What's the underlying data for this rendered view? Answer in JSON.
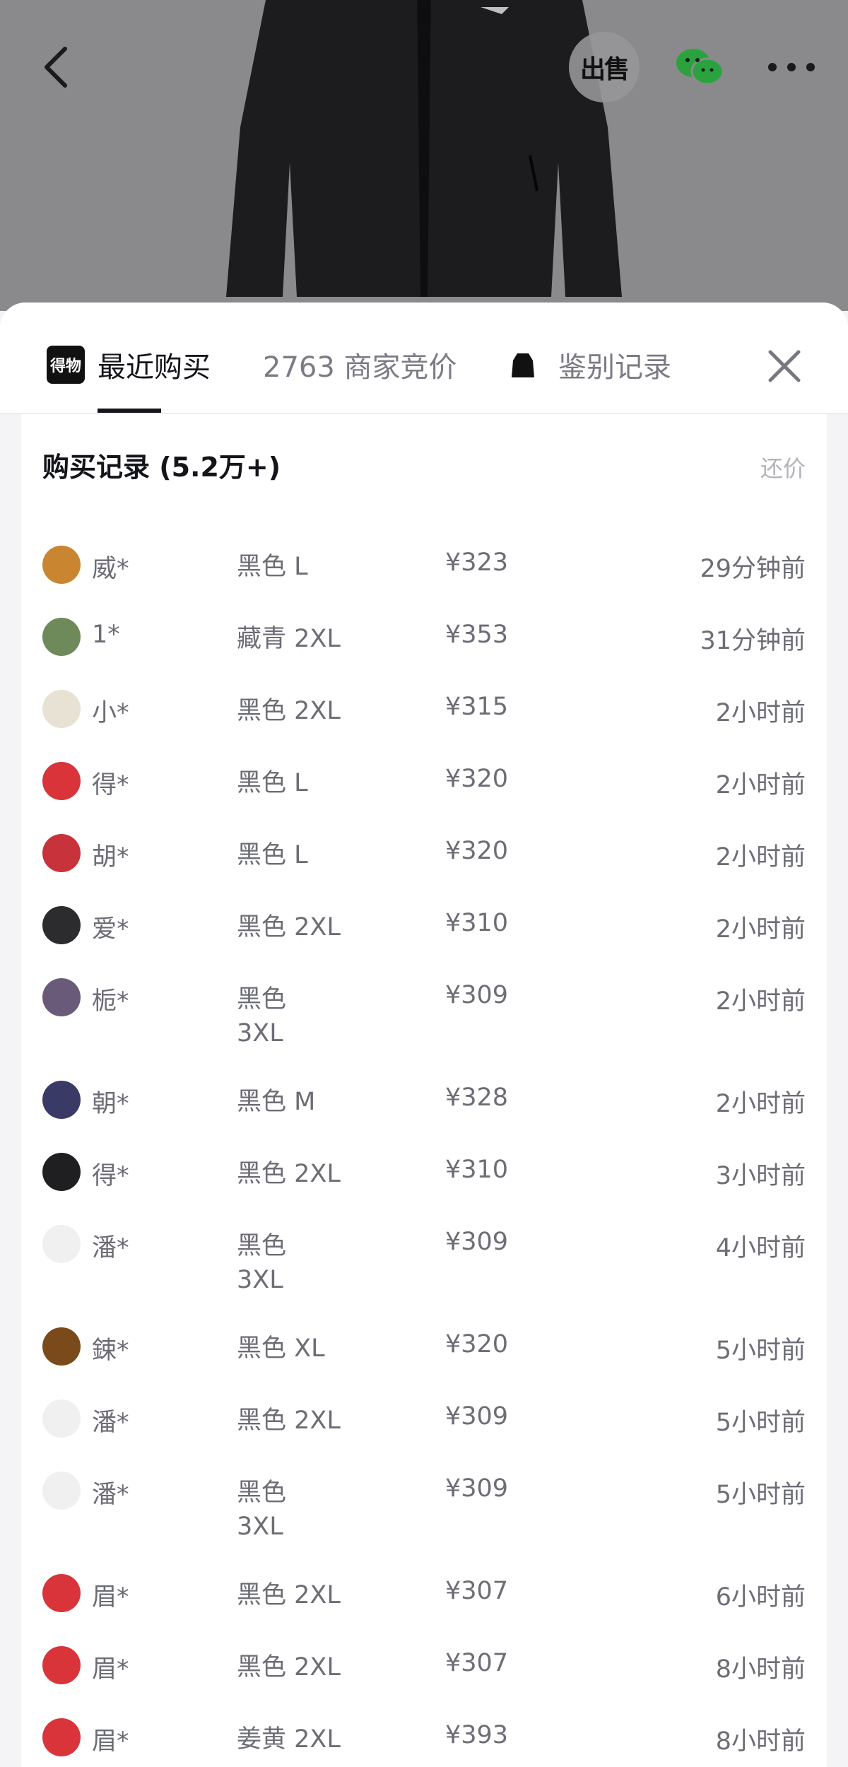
{
  "header": {
    "sell_label": "出售",
    "back_icon": "chevron-left-icon",
    "share_icon": "wechat-icon",
    "more_icon": "ellipsis-icon"
  },
  "tabs": {
    "recent": "最近购买",
    "logo_text": "得物",
    "bid": "2763 商家竞价",
    "auth": "鉴别记录",
    "close_icon": "close-icon"
  },
  "records": {
    "title": "购买记录 (5.2万+)",
    "counter_offer": "还价",
    "rows": [
      {
        "user": "威*",
        "color": "黑色",
        "size": "L",
        "price": "¥323",
        "time": "29分钟前",
        "avatar": "#c9852f"
      },
      {
        "user": "1*",
        "color": "藏青",
        "size": "2XL",
        "price": "¥353",
        "time": "31分钟前",
        "avatar": "#6f8a5a"
      },
      {
        "user": "小*",
        "color": "黑色",
        "size": "2XL",
        "price": "¥315",
        "time": "2小时前",
        "avatar": "#e8e2d4"
      },
      {
        "user": "得*",
        "color": "黑色",
        "size": "L",
        "price": "¥320",
        "time": "2小时前",
        "avatar": "#d8343a"
      },
      {
        "user": "胡*",
        "color": "黑色",
        "size": "L",
        "price": "¥320",
        "time": "2小时前",
        "avatar": "#c8323a"
      },
      {
        "user": "爱*",
        "color": "黑色",
        "size": "2XL",
        "price": "¥310",
        "time": "2小时前",
        "avatar": "#2c2c2e"
      },
      {
        "user": "栀*",
        "color": "黑色",
        "size": "3XL",
        "price": "¥309",
        "time": "2小时前",
        "avatar": "#6a5a7a",
        "wrap": true
      },
      {
        "user": "朝*",
        "color": "黑色",
        "size": "M",
        "price": "¥328",
        "time": "2小时前",
        "avatar": "#3a3a66"
      },
      {
        "user": "得*",
        "color": "黑色",
        "size": "2XL",
        "price": "¥310",
        "time": "3小时前",
        "avatar": "#1f1f22"
      },
      {
        "user": "潘*",
        "color": "黑色",
        "size": "3XL",
        "price": "¥309",
        "time": "4小时前",
        "avatar": "#f0f0f0",
        "wrap": true
      },
      {
        "user": "鋉*",
        "color": "黑色",
        "size": "XL",
        "price": "¥320",
        "time": "5小时前",
        "avatar": "#7a4a1a"
      },
      {
        "user": "潘*",
        "color": "黑色",
        "size": "2XL",
        "price": "¥309",
        "time": "5小时前",
        "avatar": "#f0f0f0"
      },
      {
        "user": "潘*",
        "color": "黑色",
        "size": "3XL",
        "price": "¥309",
        "time": "5小时前",
        "avatar": "#f0f0f0",
        "wrap": true
      },
      {
        "user": "眉*",
        "color": "黑色",
        "size": "2XL",
        "price": "¥307",
        "time": "6小时前",
        "avatar": "#d8343a"
      },
      {
        "user": "眉*",
        "color": "黑色",
        "size": "2XL",
        "price": "¥307",
        "time": "8小时前",
        "avatar": "#d8343a"
      },
      {
        "user": "眉*",
        "color": "姜黄",
        "size": "2XL",
        "price": "¥393",
        "time": "8小时前",
        "avatar": "#d8343a"
      }
    ]
  }
}
